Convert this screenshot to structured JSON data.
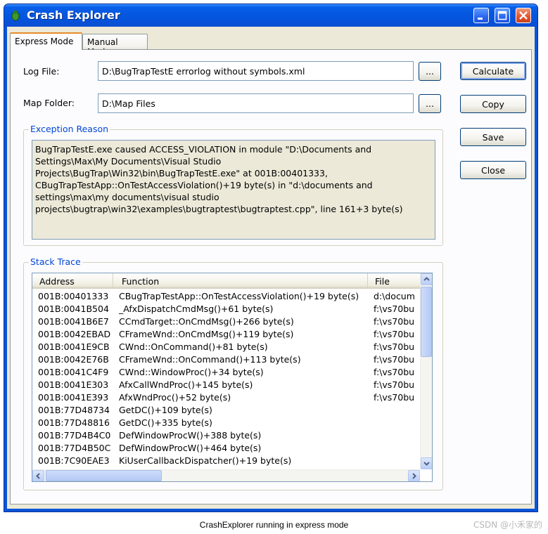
{
  "window": {
    "title": "Crash Explorer",
    "minimize_icon": "minimize-icon",
    "maximize_icon": "maximize-icon",
    "close_icon": "close-icon"
  },
  "tabs": [
    {
      "label": "Express Mode",
      "active": true
    },
    {
      "label": "Manual Mode",
      "active": false
    }
  ],
  "form": {
    "log_file_label": "Log File:",
    "log_file_value": "D:\\BugTrapTestE errorlog without symbols.xml",
    "map_folder_label": "Map Folder:",
    "map_folder_value": "D:\\Map Files",
    "browse_label": "..."
  },
  "buttons": {
    "calculate": "Calculate",
    "copy": "Copy",
    "save": "Save",
    "close": "Close"
  },
  "exception": {
    "title": "Exception Reason",
    "lines": [
      "BugTrapTestE.exe caused ACCESS_VIOLATION in module \"D:\\Documents and",
      "Settings\\Max\\My Documents\\Visual Studio",
      "Projects\\BugTrap\\Win32\\bin\\BugTrapTestE.exe\" at 001B:00401333,",
      "CBugTrapTestApp::OnTestAccessViolation()+19 byte(s) in \"d:\\documents and",
      "settings\\max\\my documents\\visual studio",
      "projects\\bugtrap\\win32\\examples\\bugtraptest\\bugtraptest.cpp\", line 161+3 byte(s)"
    ]
  },
  "stack": {
    "title": "Stack Trace",
    "columns": [
      "Address",
      "Function",
      "File"
    ],
    "rows": [
      [
        "001B:00401333",
        "CBugTrapTestApp::OnTestAccessViolation()+19 byte(s)",
        "d:\\docum"
      ],
      [
        "001B:0041B504",
        "_AfxDispatchCmdMsg()+61 byte(s)",
        "f:\\vs70bu"
      ],
      [
        "001B:0041B6E7",
        "CCmdTarget::OnCmdMsg()+266 byte(s)",
        "f:\\vs70bu"
      ],
      [
        "001B:0042EBAD",
        "CFrameWnd::OnCmdMsg()+119 byte(s)",
        "f:\\vs70bu"
      ],
      [
        "001B:0041E9CB",
        "CWnd::OnCommand()+81 byte(s)",
        "f:\\vs70bu"
      ],
      [
        "001B:0042E76B",
        "CFrameWnd::OnCommand()+113 byte(s)",
        "f:\\vs70bu"
      ],
      [
        "001B:0041C4F9",
        "CWnd::WindowProc()+34 byte(s)",
        "f:\\vs70bu"
      ],
      [
        "001B:0041E303",
        "AfxCallWndProc()+145 byte(s)",
        "f:\\vs70bu"
      ],
      [
        "001B:0041E393",
        "AfxWndProc()+52 byte(s)",
        "f:\\vs70bu"
      ],
      [
        "001B:77D48734",
        "GetDC()+109 byte(s)",
        ""
      ],
      [
        "001B:77D48816",
        "GetDC()+335 byte(s)",
        ""
      ],
      [
        "001B:77D4B4C0",
        "DefWindowProcW()+388 byte(s)",
        ""
      ],
      [
        "001B:77D4B50C",
        "DefWindowProcW()+464 byte(s)",
        ""
      ],
      [
        "001B:7C90EAE3",
        "KiUserCallbackDispatcher()+19 byte(s)",
        ""
      ]
    ]
  },
  "caption": "CrashExplorer running in express mode",
  "watermark": "CSDN @小禾家的",
  "colors": {
    "titlebar": "#0553dc",
    "group_title": "#0046d5",
    "dialog_bg": "#ece9d8",
    "close_button": "#e4522e"
  }
}
